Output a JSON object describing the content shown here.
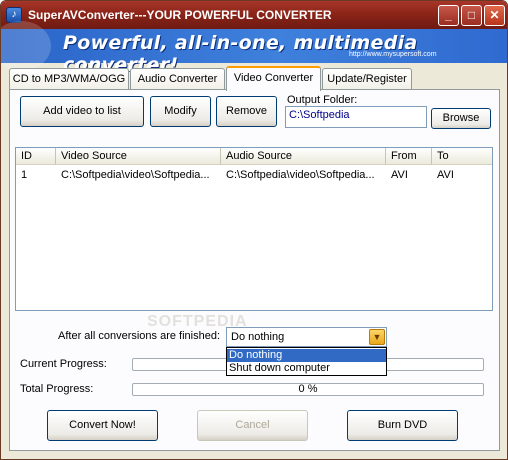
{
  "window": {
    "title": "SuperAVConverter---YOUR POWERFUL CONVERTER"
  },
  "banner": {
    "slogan": "Powerful, all-in-one, multimedia converter!",
    "url": "http://www.mysupersoft.com"
  },
  "tabs": [
    {
      "label": "CD to MP3/WMA/OGG"
    },
    {
      "label": "Audio Converter"
    },
    {
      "label": "Video Converter"
    },
    {
      "label": "Update/Register"
    }
  ],
  "toolbar": {
    "add_label": "Add video to list",
    "modify_label": "Modify",
    "remove_label": "Remove",
    "output_folder_label": "Output Folder:",
    "output_folder_value": "C:\\Softpedia",
    "browse_label": "Browse"
  },
  "list": {
    "columns": [
      "ID",
      "Video Source",
      "Audio Source",
      "From",
      "To"
    ],
    "rows": [
      {
        "id": "1",
        "video": "C:\\Softpedia\\video\\Softpedia...",
        "audio": "C:\\Softpedia\\video\\Softpedia...",
        "from": "AVI",
        "to": "AVI"
      }
    ]
  },
  "after": {
    "label": "After all conversions are finished:",
    "selected": "Do nothing",
    "options": [
      "Do nothing",
      "Shut down computer"
    ]
  },
  "progress": {
    "current_label": "Current Progress:",
    "current_value": 0,
    "total_label": "Total Progress:",
    "total_value": 0,
    "total_text": "0 %"
  },
  "actions": {
    "convert_label": "Convert Now!",
    "cancel_label": "Cancel",
    "burn_label": "Burn DVD"
  },
  "watermark": "SOFTPEDIA"
}
